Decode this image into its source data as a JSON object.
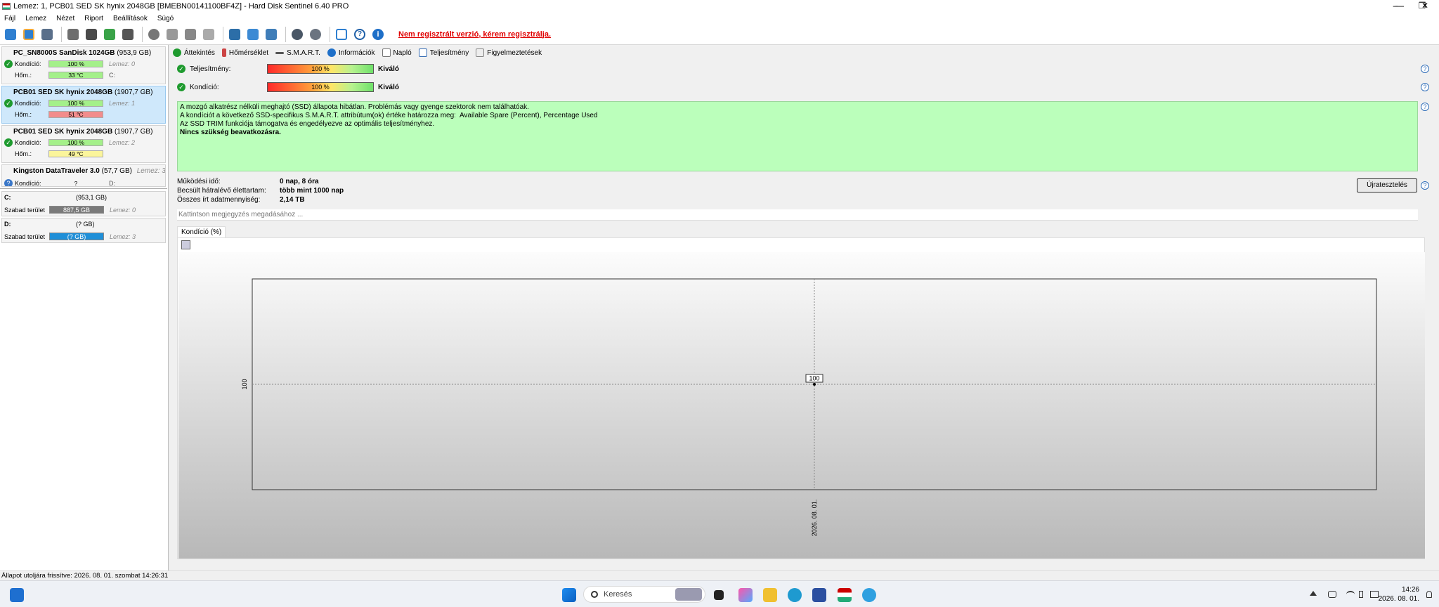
{
  "window": {
    "title": "Lemez: 1, PCB01 SED SK hynix 2048GB [BMEBN00141100BF4Z]  -  Hard Disk Sentinel 6.40 PRO"
  },
  "menu": [
    "Fájl",
    "Lemez",
    "Nézet",
    "Riport",
    "Beállítások",
    "Súgó"
  ],
  "toolbar": {
    "register_link": "Nem regisztrált verzió, kérem regisztrálja."
  },
  "disks": [
    {
      "name": "PC_SN8000S SanDisk 1024GB",
      "size": "(953,9 GB)",
      "condition_label": "Kondíció:",
      "condition": "100 %",
      "disk_label": "Lemez: 0",
      "temp_label": "Hőm.:",
      "temp": "33 °C",
      "drive": "C:"
    },
    {
      "name": "PCB01 SED SK hynix 2048GB",
      "size": "(1907,7 GB)",
      "condition_label": "Kondíció:",
      "condition": "100 %",
      "disk_label": "Lemez: 1",
      "temp_label": "Hőm.:",
      "temp": "51 °C",
      "drive": ""
    },
    {
      "name": "PCB01 SED SK hynix 2048GB",
      "size": "(1907,7 GB)",
      "condition_label": "Kondíció:",
      "condition": "100 %",
      "disk_label": "Lemez: 2",
      "temp_label": "Hőm.:",
      "temp": "49 °C",
      "drive": ""
    },
    {
      "name": "Kingston DataTraveler 3.0",
      "size": "(57,7 GB)",
      "condition_label": "Kondíció:",
      "condition": "?",
      "disk_label": "Lemez: 3",
      "temp_label": "",
      "temp": "",
      "drive": "D:"
    }
  ],
  "volumes": [
    {
      "name": "C:",
      "size": "(953,1 GB)",
      "free_label": "Szabad terület",
      "free": "887,5 GB",
      "disk": "Lemez: 0",
      "color": "#7a7a7a"
    },
    {
      "name": "D:",
      "size": "(? GB)",
      "free_label": "Szabad terület",
      "free": "(? GB)",
      "disk": "Lemez: 3",
      "color": "#1f8fd8"
    }
  ],
  "tabs": [
    "Áttekintés",
    "Hőmérséklet",
    "S.M.A.R.T.",
    "Információk",
    "Napló",
    "Teljesítmény",
    "Figyelmeztetések"
  ],
  "summary": {
    "performance_label": "Teljesítmény:",
    "performance_value": "100 %",
    "performance_text": "Kiváló",
    "condition_label": "Kondíció:",
    "condition_value": "100 %",
    "condition_text": "Kiváló"
  },
  "info_lines": [
    "A mozgó alkatrész nélküli meghajtó (SSD) állapota hibátlan. Problémás vagy gyenge szektorok nem találhatóak.",
    "A kondíciót a következő SSD-specifikus S.M.A.R.T. attribútum(ok) értéke határozza meg:  Available Spare (Percent), Percentage Used",
    "Az SSD TRIM funkciója támogatva és engedélyezve az optimális teljesítményhez.",
    "",
    "Nincs szükség beavatkozásra."
  ],
  "details": [
    {
      "key": "Működési idő:",
      "value": "0 nap, 8 óra"
    },
    {
      "key": "Becsült hátralévő élettartam:",
      "value": "több mint 1000 nap"
    },
    {
      "key": "Összes írt adatmennyiség:",
      "value": "2,14 TB"
    }
  ],
  "retest_button": "Újratesztelés",
  "note_placeholder": "Kattintson megjegyzés megadásához ...",
  "chart_tab": "Kondíció  (%)",
  "chart_data": {
    "type": "line",
    "title": "",
    "xlabel": "",
    "ylabel": "",
    "x": [
      "2026. 08. 01."
    ],
    "series": [
      {
        "values": [
          100
        ]
      }
    ],
    "y_tick": "100",
    "data_label": "100"
  },
  "status_bar": "Állapot utoljára frissítve: 2026. 08. 01. szombat 14:26:31",
  "taskbar": {
    "search": "Keresés",
    "time": "14:26",
    "date": "2026. 08. 01."
  }
}
